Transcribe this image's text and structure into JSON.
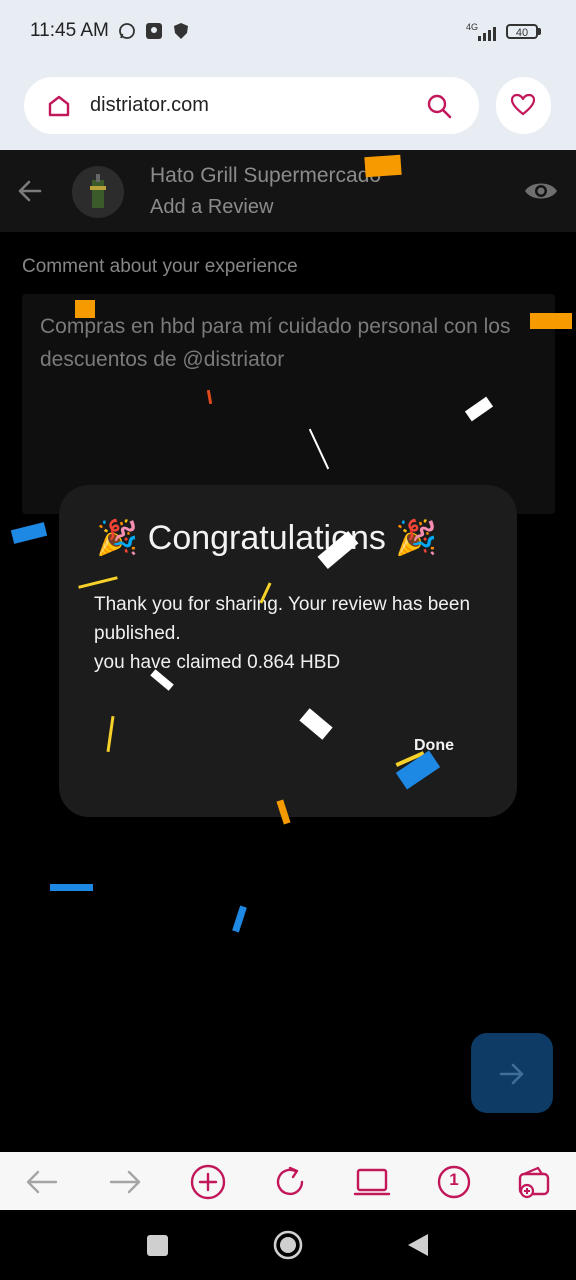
{
  "status_bar": {
    "time": "11:45 AM",
    "network": "4G",
    "battery": "40"
  },
  "browser": {
    "url": "distriator.com",
    "icons": [
      "home-icon",
      "search-icon",
      "heart-icon"
    ]
  },
  "header": {
    "store_name": "Hato Grill Supermercado",
    "subtitle": "Add a Review",
    "icons": [
      "back-arrow-icon",
      "eye-icon"
    ]
  },
  "review_form": {
    "comment_label": "Comment about your experience",
    "comment_text": "Compras en hbd para mí cuidado personal con los descuentos de @distriator"
  },
  "dialog": {
    "title": "🎉 Congratulations 🎉",
    "message_line1": "Thank you for sharing. Your review has been published.",
    "message_line2": "you have claimed 0.864 HBD",
    "done_label": "Done"
  },
  "toolbar": {
    "tab_count": "1",
    "icons": [
      "back-icon",
      "forward-icon",
      "new-tab-icon",
      "reload-icon",
      "desktop-icon",
      "tabs-icon",
      "wallet-icon"
    ]
  },
  "colors": {
    "accent": "#c2185b",
    "fab": "#0e3a66",
    "dialog_bg": "#1c1c1c",
    "status_bg": "#e8edf3"
  }
}
